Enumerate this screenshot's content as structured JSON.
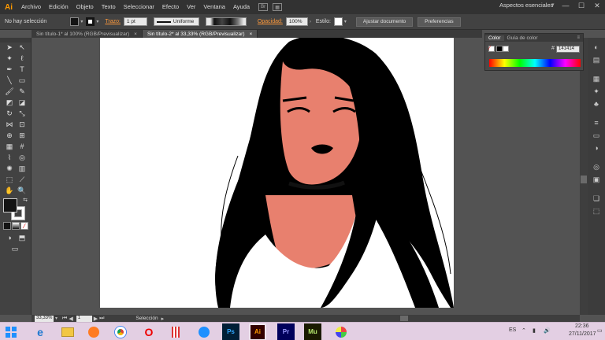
{
  "app": {
    "logo": "Ai",
    "menus": [
      "Archivo",
      "Edición",
      "Objeto",
      "Texto",
      "Seleccionar",
      "Efecto",
      "Ver",
      "Ventana",
      "Ayuda"
    ],
    "bridge_icon": "Br",
    "workspace": "Aspectos esenciales",
    "window_controls": {
      "minimize": "—",
      "maximize": "☐",
      "close": "✕"
    }
  },
  "control_bar": {
    "selection_text": "No hay selección",
    "stroke_label": "Trazo:",
    "stroke_value": "1 pt",
    "stroke_profile": "Uniforme",
    "opacity_label": "Opacidad:",
    "opacity_value": "100%",
    "style_label": "Estilo:",
    "document_setup_label": "Ajustar documento",
    "preferences_label": "Preferencias"
  },
  "tabs": [
    {
      "label": "Sin título-1* al 100% (RGB/Previsualizar)",
      "close": "×",
      "active": false
    },
    {
      "label": "Sin título-2* al 33,33% (RGB/Previsualizar)",
      "close": "×",
      "active": true
    }
  ],
  "color_panel": {
    "tabs": [
      "Color",
      "Guía de color"
    ],
    "hex_prefix": "#",
    "hex_value": "141414"
  },
  "status": {
    "zoom": "33,33%",
    "page": "1",
    "tool": "Selección"
  },
  "taskbar": {
    "apps": [
      {
        "name": "internet-explorer",
        "label": "e"
      },
      {
        "name": "file-explorer",
        "label": ""
      },
      {
        "name": "media-player",
        "label": ""
      },
      {
        "name": "chrome",
        "label": ""
      },
      {
        "name": "opera",
        "label": "O"
      },
      {
        "name": "popcorn",
        "label": ""
      },
      {
        "name": "app-wave",
        "label": ""
      },
      {
        "name": "photoshop",
        "label": "Ps"
      },
      {
        "name": "illustrator",
        "label": "Ai"
      },
      {
        "name": "premiere",
        "label": "Pr"
      },
      {
        "name": "muse",
        "label": "Mu"
      },
      {
        "name": "paint",
        "label": ""
      }
    ],
    "language": "ES",
    "time": "22:36",
    "date": "27/11/2017"
  },
  "colors": {
    "skin": "#e8806e",
    "hair": "#000000",
    "accent": "#ff9a00"
  }
}
